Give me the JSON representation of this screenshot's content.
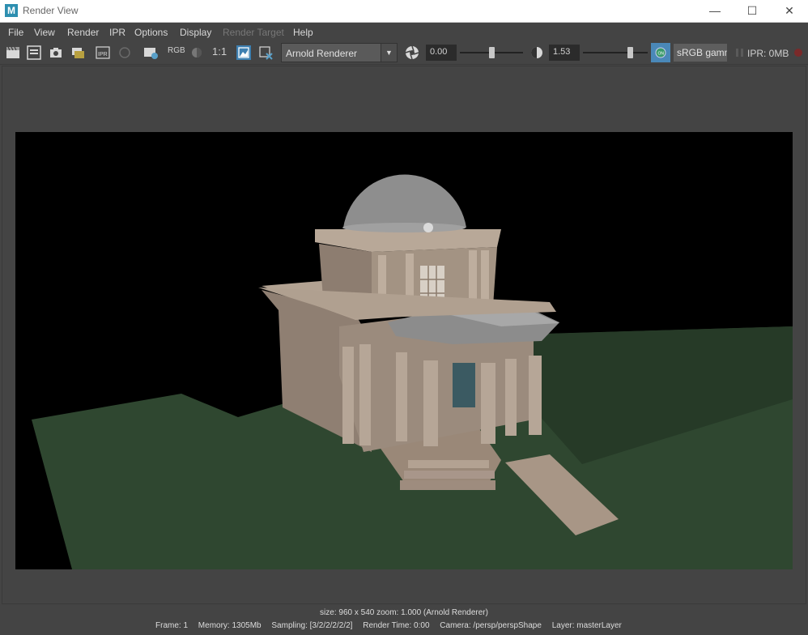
{
  "window": {
    "app_icon_letter": "M",
    "title": "Render View",
    "minimize": "—",
    "maximize": "☐",
    "close": "✕"
  },
  "menu": {
    "file": "File",
    "view": "View",
    "render": "Render",
    "ipr": "IPR",
    "options": "Options",
    "display": "Display",
    "render_target": "Render Target",
    "help": "Help"
  },
  "toolbar": {
    "rgb_label": "RGB",
    "ratio_label": "1:1",
    "renderer": "Arnold Renderer",
    "exposure": "0.00",
    "gamma_value": "1.53",
    "color_space": "sRGB gamma",
    "ipr_memory": "IPR: 0MB",
    "exposure_fraction": 0.5,
    "gamma_fraction": 0.72
  },
  "status": {
    "size_line": "size: 960 x 540 zoom: 1.000     (Arnold Renderer)",
    "frame": "Frame: 1",
    "memory": "Memory: 1305Mb",
    "sampling": "Sampling: [3/2/2/2/2/2]",
    "render_time": "Render Time: 0:00",
    "camera": "Camera: /persp/perspShape",
    "layer": "Layer: masterLayer"
  },
  "colors": {
    "ground": "#2f4730",
    "building": "#a89888",
    "dome": "#8a8a8a",
    "accent": "#3d7fb0"
  }
}
